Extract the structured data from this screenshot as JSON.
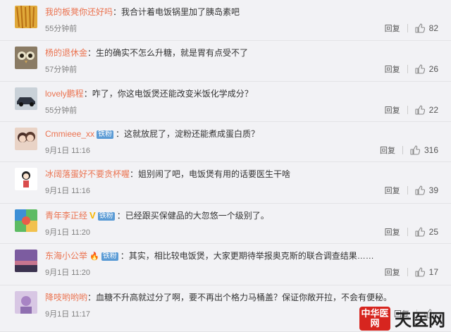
{
  "comments": [
    {
      "username": "我的板凳你还好吗",
      "text": "我合计着电饭锅里加了胰岛素吧",
      "time": "55分钟前",
      "reply": "回复",
      "likes": "82",
      "badge": "",
      "avatar": "fries",
      "avatar_color": "#c8922c"
    },
    {
      "username": "杨的退休金",
      "text": "生的确实不怎么升糖，就是胃有点受不了",
      "time": "57分钟前",
      "reply": "回复",
      "likes": "26",
      "badge": "",
      "avatar": "owl",
      "avatar_color": "#7a6a55"
    },
    {
      "username": "lovely鹏程",
      "text": "咋了，你这电饭煲还能改变米饭化学成分？",
      "time": "55分钟前",
      "reply": "回复",
      "likes": "22",
      "badge": "",
      "avatar": "car",
      "avatar_color": "#9aa5b0"
    },
    {
      "username": "Cmmieee_xx",
      "text": "这就放屁了，淀粉还能煮成蛋白质？",
      "time": "9月1日 11:16",
      "reply": "回复",
      "likes": "316",
      "badge": "铁粉",
      "avatar": "girls",
      "avatar_color": "#d9b8a8"
    },
    {
      "username": "冰阔落蛋好不要贪杯喔",
      "text": "姐别闹了吧，电饭煲有用的话要医生干啥",
      "time": "9月1日 11:16",
      "reply": "回复",
      "likes": "39",
      "badge": "",
      "avatar": "cartoon",
      "avatar_color": "#ffffff"
    },
    {
      "username": "青年李正经",
      "text": "已经跟买保健品的大忽悠一个级别了。",
      "time": "9月1日 11:20",
      "reply": "回复",
      "likes": "25",
      "badge": "铁粉",
      "vbadge": "V",
      "avatar": "colorful",
      "avatar_color": "#4aa3df"
    },
    {
      "username": "东海小公举",
      "text": "其实，相比较电饭煲，大家更期待举报奥克斯的联合调查结果……",
      "time": "9月1日 11:20",
      "reply": "回复",
      "likes": "17",
      "badge": "铁粉",
      "flame": "🔥",
      "avatar": "sunset",
      "avatar_color": "#a0608a"
    },
    {
      "username": "降吱哟哟哟",
      "text": "血糖不升高就过分了啊，要不再出个格力马桶盖？保证你敞开拉，不会有便秘。",
      "time": "9月1日 11:17",
      "reply": "回复",
      "likes": "",
      "badge": "",
      "avatar": "purple",
      "avatar_color": "#b89ac8"
    }
  ],
  "watermark": {
    "logo_text": "中华医网",
    "site_text": "天医网"
  },
  "colors": {
    "username": "#eb7350",
    "badge": "#5b9bd5",
    "background": "#f2f2f5"
  },
  "icons": {
    "like": "thumbs-up-icon"
  }
}
